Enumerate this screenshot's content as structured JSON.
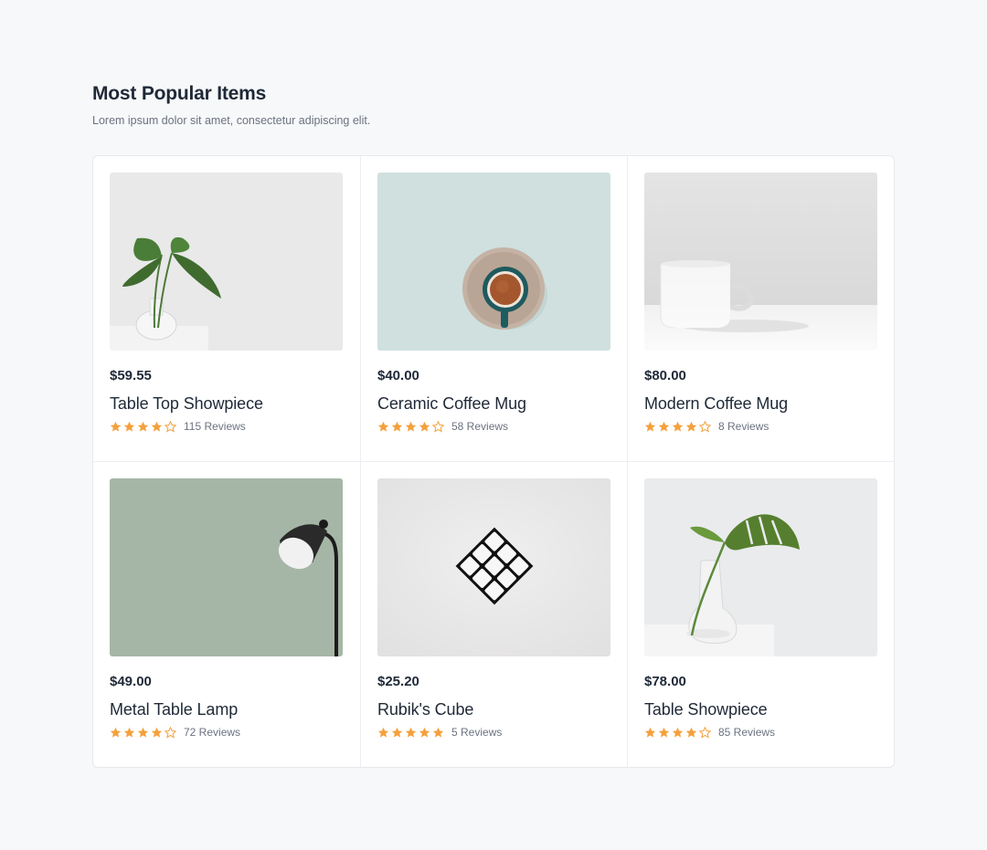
{
  "section": {
    "title": "Most Popular Items",
    "subtitle": "Lorem ipsum dolor sit amet, consectetur adipiscing elit."
  },
  "colors": {
    "star_filled": "#f4a13d",
    "star_empty": "#f4a13d",
    "page_bg": "#f7f8fa",
    "card_bg": "#ffffff"
  },
  "products": [
    {
      "price": "$59.55",
      "name": "Table Top Showpiece",
      "rating": 4,
      "reviews": "115 Reviews",
      "image": "plant-in-glass-vase"
    },
    {
      "price": "$40.00",
      "name": "Ceramic Coffee Mug",
      "rating": 4,
      "reviews": "58 Reviews",
      "image": "coffee-cup-top-view"
    },
    {
      "price": "$80.00",
      "name": "Modern Coffee Mug",
      "rating": 4,
      "reviews": "8 Reviews",
      "image": "white-mug"
    },
    {
      "price": "$49.00",
      "name": "Metal Table Lamp",
      "rating": 4,
      "reviews": "72 Reviews",
      "image": "floor-lamp"
    },
    {
      "price": "$25.20",
      "name": "Rubik's Cube",
      "rating": 5,
      "reviews": "5 Reviews",
      "image": "rubiks-cube"
    },
    {
      "price": "$78.00",
      "name": "Table Showpiece",
      "rating": 4,
      "reviews": "85 Reviews",
      "image": "monstera-leaf-vase"
    }
  ]
}
